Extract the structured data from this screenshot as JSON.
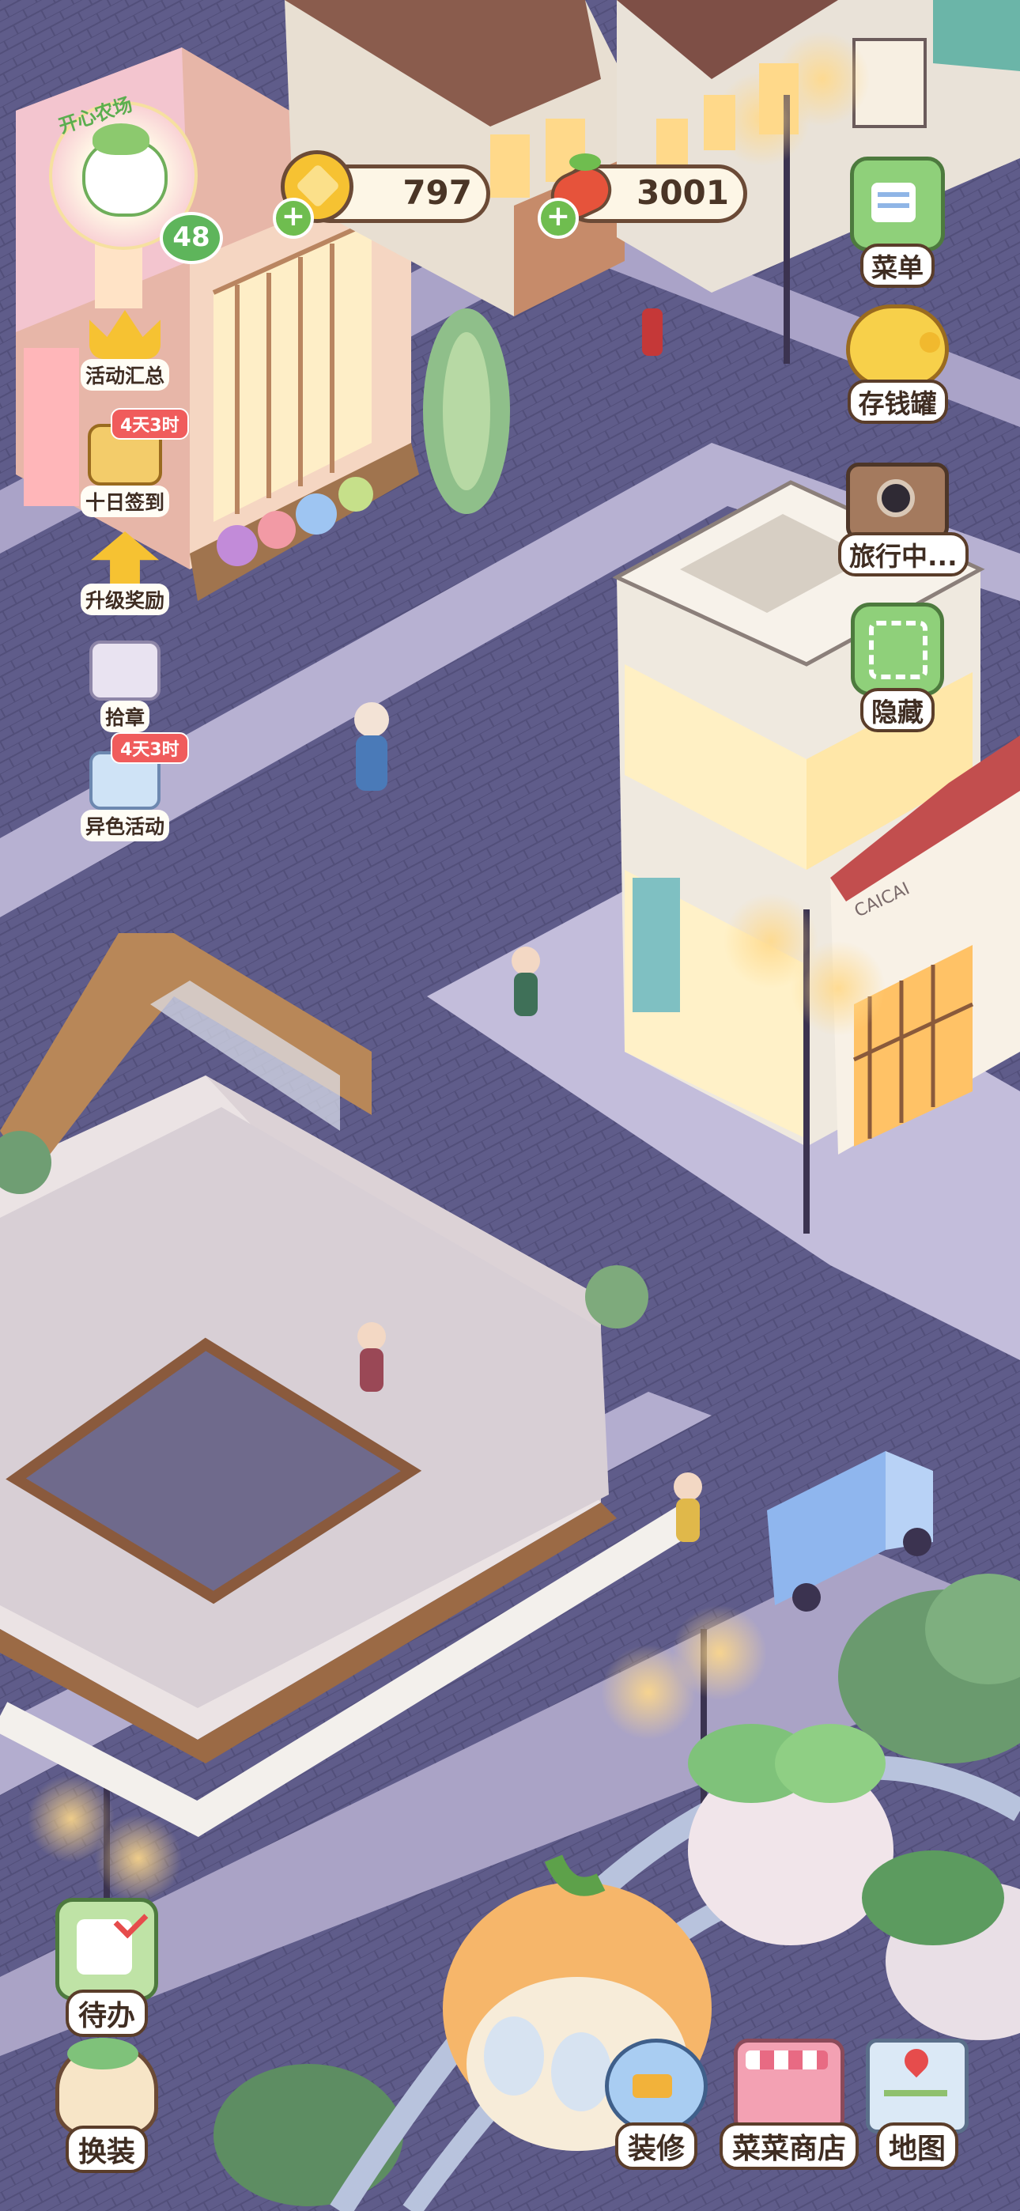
{
  "player": {
    "level": "48",
    "avatar_text": "开心农场"
  },
  "currency": {
    "coins": "797",
    "vegetables": "3001"
  },
  "right_menu": [
    {
      "label": "菜单",
      "icon": "menu-icon"
    },
    {
      "label": "存钱罐",
      "icon": "piggy-bank-icon"
    },
    {
      "label": "旅行中...",
      "icon": "camera-icon"
    },
    {
      "label": "隐藏",
      "icon": "hide-icon"
    }
  ],
  "left_events": [
    {
      "label": "活动汇总",
      "icon": "crown-icon",
      "badge": ""
    },
    {
      "label": "十日签到",
      "icon": "checkin-icon",
      "badge": "4天3时"
    },
    {
      "label": "升级奖励",
      "icon": "upgrade-icon",
      "badge": ""
    },
    {
      "label": "拾章",
      "icon": "stamp-icon",
      "badge": ""
    },
    {
      "label": "异色活动",
      "icon": "color-event-icon",
      "badge": "4天3时"
    }
  ],
  "bottom_left": [
    {
      "label": "待办",
      "icon": "todo-icon"
    },
    {
      "label": "换装",
      "icon": "dressup-icon"
    }
  ],
  "bottom_right": [
    {
      "label": "装修",
      "icon": "decorate-icon"
    },
    {
      "label": "菜菜商店",
      "icon": "shop-icon"
    },
    {
      "label": "地图",
      "icon": "map-icon"
    }
  ],
  "scene_signs": {
    "shop_sign": "CAICAI"
  },
  "colors": {
    "coin": "#f6c232",
    "plus": "#6fbd4f",
    "badge": "#f05c5c",
    "outline": "#5a3d2a"
  }
}
